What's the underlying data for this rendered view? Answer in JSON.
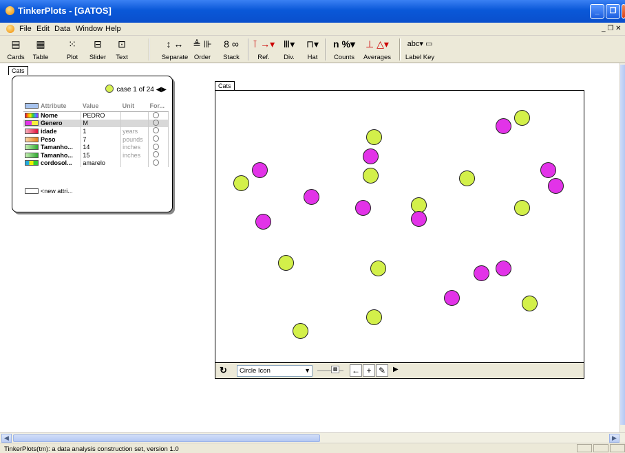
{
  "window": {
    "title": "TinkerPlots - [GATOS]"
  },
  "menu": [
    "File",
    "Edit",
    "Data",
    "Window",
    "Help"
  ],
  "toolbar": {
    "objects": [
      {
        "label": "Cards",
        "icon": "cards-icon"
      },
      {
        "label": "Table",
        "icon": "table-icon"
      },
      {
        "label": "Plot",
        "icon": "plot-icon"
      },
      {
        "label": "Slider",
        "icon": "slider-icon"
      },
      {
        "label": "Text",
        "icon": "text-icon"
      }
    ],
    "plot_tools": [
      {
        "label": "Separate",
        "glyph": "↕ ↔"
      },
      {
        "label": "Order",
        "glyph": "≜ ⊪"
      },
      {
        "label": "Stack",
        "glyph": "8 ∞"
      },
      {
        "label": "Ref.",
        "glyph": "⊺ →▾"
      },
      {
        "label": "Div.",
        "glyph": "Ⅲ▾"
      },
      {
        "label": "Hat",
        "glyph": "⊓▾"
      },
      {
        "label": "Counts",
        "glyph": "n %▾"
      },
      {
        "label": "Averages",
        "glyph": "⊥ △▾"
      },
      {
        "label": "Label Key",
        "glyph": "abc▾ ▭"
      }
    ]
  },
  "workspace": {
    "tab_label": "Cats"
  },
  "card": {
    "case_text": "case 1 of 24",
    "headers": [
      "Attribute",
      "Value",
      "Unit",
      "For..."
    ],
    "rows": [
      {
        "name": "Nome",
        "value": "PEDRO",
        "unit": "",
        "swatch": "rainbow"
      },
      {
        "name": "Genero",
        "value": "M",
        "unit": "",
        "swatch": "magenta-yellow",
        "selected": true
      },
      {
        "name": "idade",
        "value": "1",
        "unit": "years",
        "swatch": "red"
      },
      {
        "name": "Peso",
        "value": "7",
        "unit": "pounds",
        "swatch": "orange"
      },
      {
        "name": "Tamanho...",
        "value": "14",
        "unit": "inches",
        "swatch": "green"
      },
      {
        "name": "Tamanho...",
        "value": "15",
        "unit": "inches",
        "swatch": "green"
      },
      {
        "name": "cordosol...",
        "value": "amarelo",
        "unit": "",
        "swatch": "cyan-green"
      }
    ],
    "new_attribute": "<new attri..."
  },
  "plot": {
    "tab_label": "Cats",
    "icon_select": "Circle Icon",
    "colors": {
      "F": "#e233e8",
      "M": "#d3f04a"
    },
    "points": [
      {
        "g": "F",
        "x": 0.78,
        "y": 0.13
      },
      {
        "g": "M",
        "x": 0.83,
        "y": 0.1
      },
      {
        "g": "M",
        "x": 0.43,
        "y": 0.17
      },
      {
        "g": "F",
        "x": 0.42,
        "y": 0.24
      },
      {
        "g": "M",
        "x": 0.42,
        "y": 0.31
      },
      {
        "g": "F",
        "x": 0.12,
        "y": 0.29
      },
      {
        "g": "M",
        "x": 0.07,
        "y": 0.34
      },
      {
        "g": "M",
        "x": 0.68,
        "y": 0.32
      },
      {
        "g": "F",
        "x": 0.9,
        "y": 0.29
      },
      {
        "g": "F",
        "x": 0.92,
        "y": 0.35
      },
      {
        "g": "F",
        "x": 0.26,
        "y": 0.39
      },
      {
        "g": "F",
        "x": 0.4,
        "y": 0.43
      },
      {
        "g": "M",
        "x": 0.55,
        "y": 0.42
      },
      {
        "g": "F",
        "x": 0.55,
        "y": 0.47
      },
      {
        "g": "M",
        "x": 0.83,
        "y": 0.43
      },
      {
        "g": "F",
        "x": 0.13,
        "y": 0.48
      },
      {
        "g": "M",
        "x": 0.19,
        "y": 0.63
      },
      {
        "g": "M",
        "x": 0.44,
        "y": 0.65
      },
      {
        "g": "F",
        "x": 0.72,
        "y": 0.67
      },
      {
        "g": "F",
        "x": 0.78,
        "y": 0.65
      },
      {
        "g": "F",
        "x": 0.64,
        "y": 0.76
      },
      {
        "g": "M",
        "x": 0.85,
        "y": 0.78
      },
      {
        "g": "M",
        "x": 0.43,
        "y": 0.83
      },
      {
        "g": "M",
        "x": 0.23,
        "y": 0.88
      }
    ]
  },
  "statusbar": {
    "text": "TinkerPlots(tm): a data analysis construction set, version 1.0"
  }
}
